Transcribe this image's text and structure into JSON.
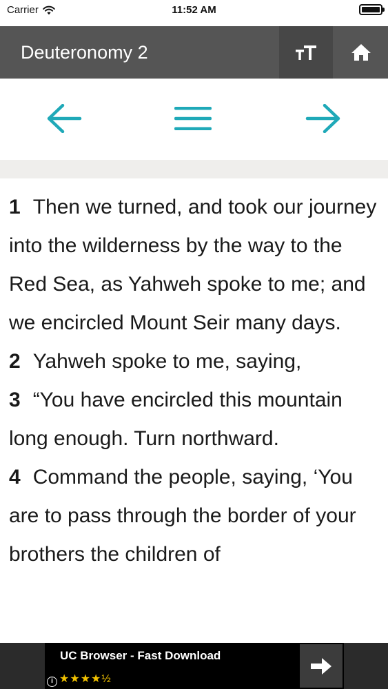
{
  "status_bar": {
    "carrier": "Carrier",
    "time": "11:52 AM",
    "battery_level": 1.0
  },
  "header": {
    "title": "Deuteronomy 2",
    "text_size_icon": "text-size-icon",
    "home_icon": "home-icon",
    "background_color": "#555555"
  },
  "nav": {
    "prev_icon": "arrow-left-icon",
    "menu_icon": "menu-icon",
    "next_icon": "arrow-right-icon",
    "accent_color": "#1fa9b8"
  },
  "verses": [
    {
      "number": "1",
      "text": "Then we turned, and took our journey into the wilderness by the way to the Red Sea, as Yahweh spoke to me; and we encircled Mount Seir many days."
    },
    {
      "number": "2",
      "text": "Yahweh spoke to me, saying,"
    },
    {
      "number": "3",
      "text": "“You have encircled this mountain long enough. Turn northward."
    },
    {
      "number": "4",
      "text": "Command the people, saying, ‘You are to pass through the border of your brothers the children of"
    }
  ],
  "ad": {
    "title": "UC Browser - Fast Download",
    "info_label": "i",
    "rating_stars": "★★★★½",
    "rating_value": 4.5,
    "arrow_icon": "arrow-right-icon"
  }
}
